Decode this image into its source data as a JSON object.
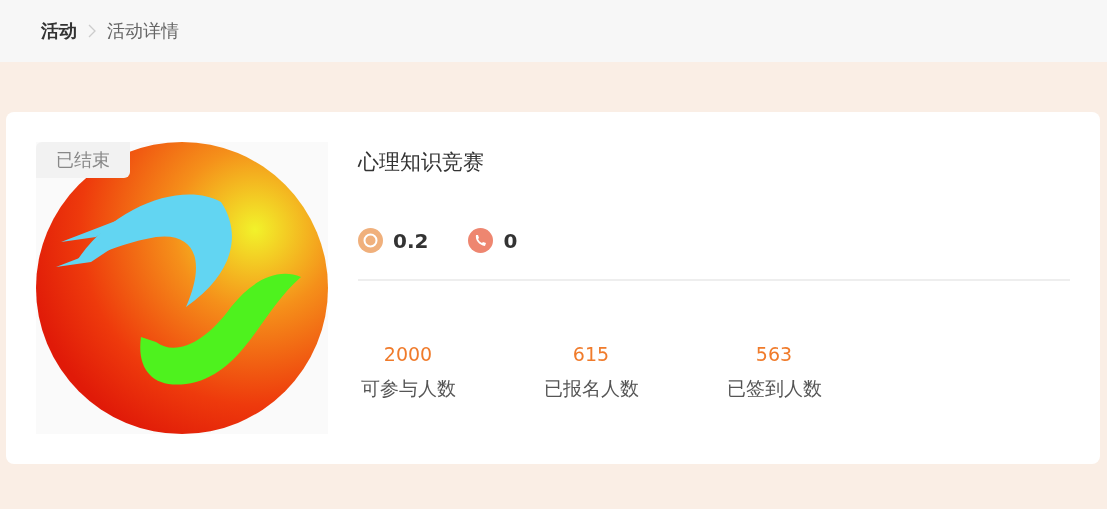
{
  "breadcrumb": [
    {
      "label": "活动",
      "current": false
    },
    {
      "label": "活动详情",
      "current": true
    }
  ],
  "activity": {
    "status_tag": "已结束",
    "title": "心理知识竞赛",
    "metrics": [
      {
        "kind": "points",
        "value": "0.2"
      },
      {
        "kind": "phone",
        "value": "0"
      }
    ],
    "stats": [
      {
        "count": "2000",
        "label": "可参与人数"
      },
      {
        "count": "615",
        "label": "已报名人数"
      },
      {
        "count": "563",
        "label": "已签到人数"
      }
    ]
  }
}
